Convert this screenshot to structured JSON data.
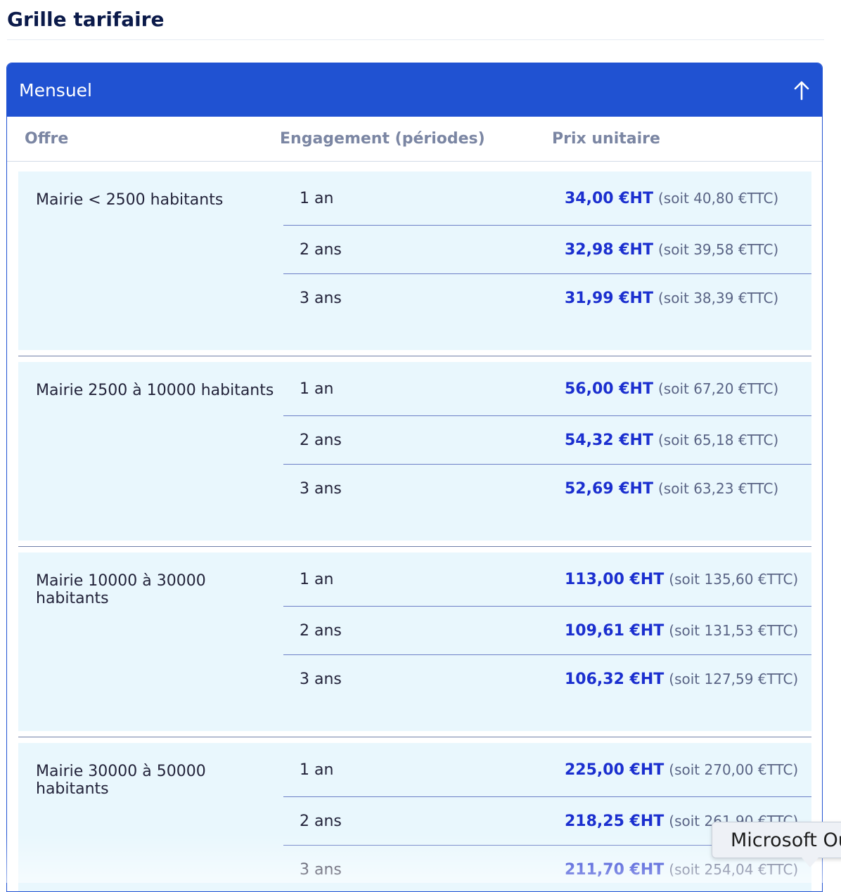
{
  "page": {
    "title": "Grille tarifaire"
  },
  "accordion": {
    "title": "Mensuel",
    "toggle_icon": "arrow-up-icon",
    "accent": "#2052d2"
  },
  "columns": {
    "offer": "Offre",
    "engagement": "Engagement (périodes)",
    "unit_price": "Prix unitaire"
  },
  "groups": [
    {
      "offer": "Mairie < 2500 habitants",
      "rows": [
        {
          "period": "1 an",
          "ht": "34,00 €HT",
          "ttc": "(soit 40,80 €TTC)"
        },
        {
          "period": "2 ans",
          "ht": "32,98 €HT",
          "ttc": "(soit 39,58 €TTC)"
        },
        {
          "period": "3 ans",
          "ht": "31,99 €HT",
          "ttc": "(soit 38,39 €TTC)"
        }
      ]
    },
    {
      "offer": "Mairie 2500 à 10000 habitants",
      "rows": [
        {
          "period": "1 an",
          "ht": "56,00 €HT",
          "ttc": "(soit 67,20 €TTC)"
        },
        {
          "period": "2 ans",
          "ht": "54,32 €HT",
          "ttc": "(soit 65,18 €TTC)"
        },
        {
          "period": "3 ans",
          "ht": "52,69 €HT",
          "ttc": "(soit 63,23 €TTC)"
        }
      ]
    },
    {
      "offer": "Mairie 10000 à 30000 habitants",
      "rows": [
        {
          "period": "1 an",
          "ht": "113,00 €HT",
          "ttc": "(soit 135,60 €TTC)"
        },
        {
          "period": "2 ans",
          "ht": "109,61 €HT",
          "ttc": "(soit 131,53 €TTC)"
        },
        {
          "period": "3 ans",
          "ht": "106,32 €HT",
          "ttc": "(soit 127,59 €TTC)"
        }
      ]
    },
    {
      "offer": "Mairie 30000 à 50000 habitants",
      "rows": [
        {
          "period": "1 an",
          "ht": "225,00 €HT",
          "ttc": "(soit 270,00 €TTC)"
        },
        {
          "period": "2 ans",
          "ht": "218,25 €HT",
          "ttc": "(soit 261,90 €TTC)"
        },
        {
          "period": "3 ans",
          "ht": "211,70 €HT",
          "ttc": "(soit 254,04 €TTC)"
        }
      ]
    }
  ],
  "tooltip": {
    "text": "Microsoft Ou"
  }
}
